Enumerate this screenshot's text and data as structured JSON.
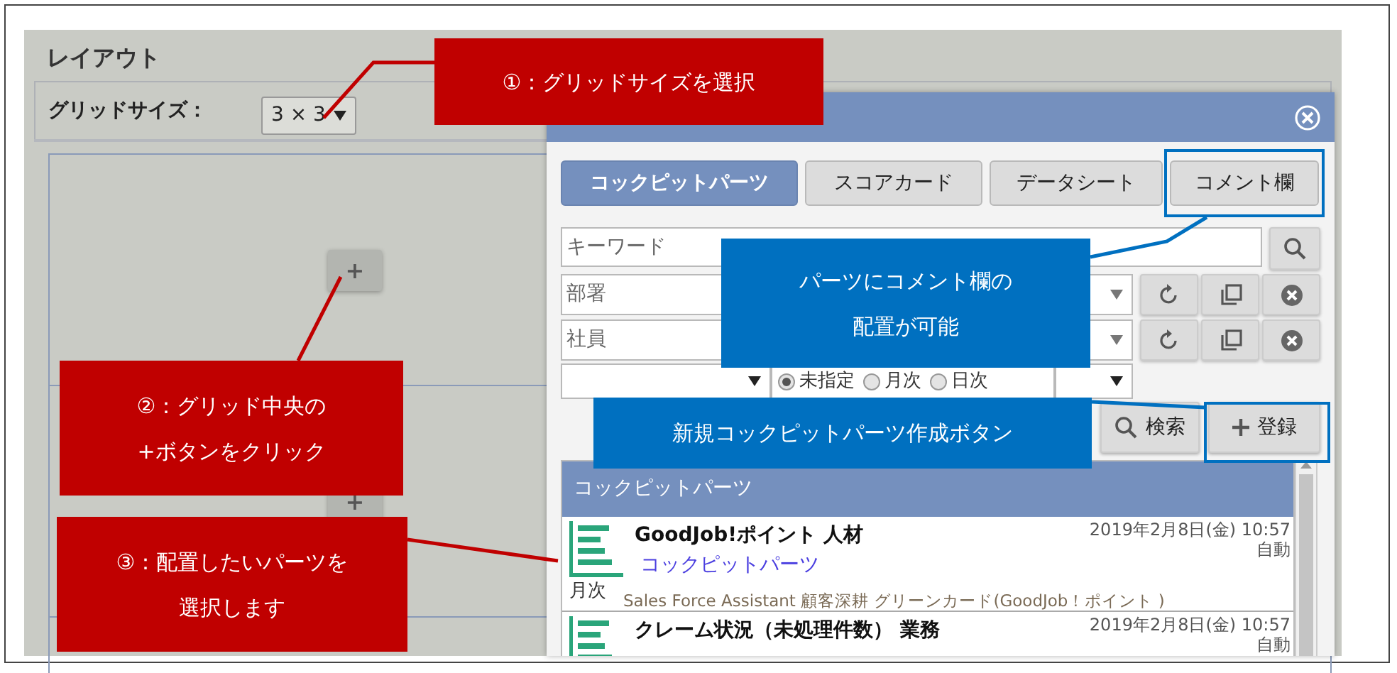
{
  "layout": {
    "title": "レイアウト",
    "grid_size_label": "グリッドサイズ：",
    "grid_size": "3 × 3",
    "add_buttons": [
      "+",
      "+"
    ]
  },
  "dialog": {
    "tabs": [
      {
        "label": "コックピットパーツ",
        "selected": true
      },
      {
        "label": "スコアカード",
        "selected": false
      },
      {
        "label": "データシート",
        "selected": false
      },
      {
        "label": "コメント欄",
        "selected": false
      }
    ],
    "keyword": {
      "placeholder": "キーワード"
    },
    "filters": [
      {
        "placeholder": "部署"
      },
      {
        "placeholder": "社員"
      }
    ],
    "period_options": [
      {
        "label": "未指定",
        "selected": true
      },
      {
        "label": "月次",
        "selected": false
      },
      {
        "label": "日次",
        "selected": false
      }
    ],
    "search_button": "検索",
    "register_button": "登録",
    "list": {
      "header": "コックピットパーツ",
      "items": [
        {
          "title": "GoodJob!ポイント 人材",
          "link": "コックピットパーツ",
          "period": "月次",
          "description": "Sales Force Assistant 顧客深耕 グリーンカード(GoodJob！ポイント )",
          "date": "2019年2月8日(金) 10:57",
          "mode": "自動"
        },
        {
          "title": "クレーム状況（未処理件数） 業務",
          "date": "2019年2月8日(金) 10:57",
          "mode": "自動"
        }
      ]
    }
  },
  "annotations": [
    {
      "lines": [
        "①：グリッドサイズを選択"
      ],
      "color": "#c00000"
    },
    {
      "lines": [
        "②：グリッド中央の",
        "+ボタンをクリック"
      ],
      "color": "#c00000"
    },
    {
      "lines": [
        "③：配置したいパーツを",
        "選択します"
      ],
      "color": "#c00000"
    },
    {
      "lines": [
        "パーツにコメント欄の",
        "配置が可能"
      ],
      "color": "#0070c0"
    },
    {
      "lines": [
        "新規コックピットパーツ作成ボタン"
      ],
      "color": "#0070c0"
    }
  ]
}
